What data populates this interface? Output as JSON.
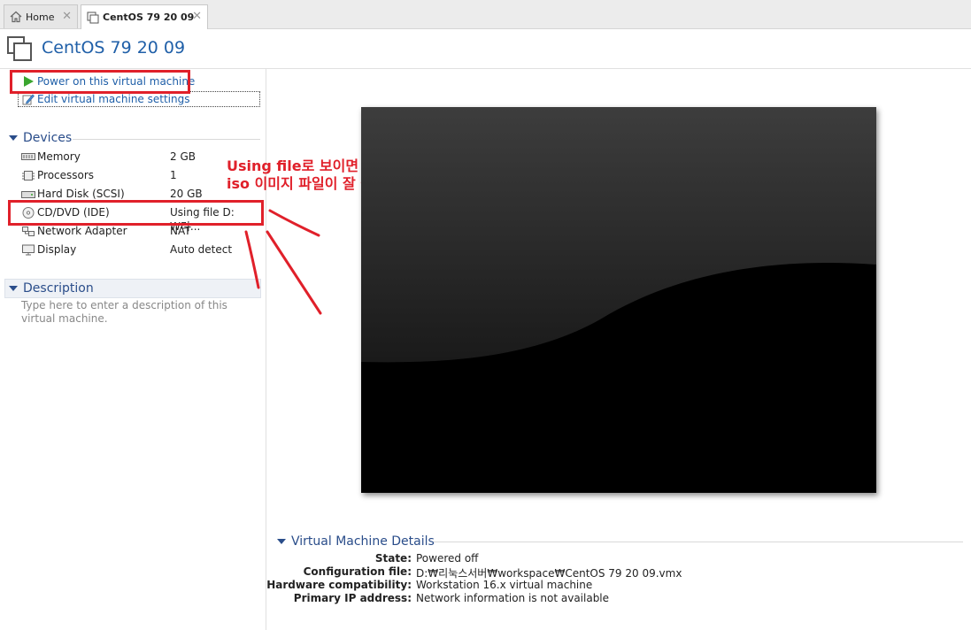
{
  "tabs": [
    {
      "label": "Home"
    },
    {
      "label": "CentOS 79 20 09"
    }
  ],
  "header": {
    "title": "CentOS 79 20 09"
  },
  "actions": {
    "power_on": "Power on this virtual machine",
    "edit_settings": "Edit virtual machine settings"
  },
  "devices": {
    "heading": "Devices",
    "items": [
      {
        "name": "Memory",
        "value": "2 GB"
      },
      {
        "name": "Processors",
        "value": "1"
      },
      {
        "name": "Hard Disk (SCSI)",
        "value": "20 GB"
      },
      {
        "name": "CD/DVD (IDE)",
        "value": "Using file D:₩리..."
      },
      {
        "name": "Network Adapter",
        "value": "NAT"
      },
      {
        "name": "Display",
        "value": "Auto detect"
      }
    ]
  },
  "description": {
    "heading": "Description",
    "placeholder": "Type here to enter a description of this virtual machine."
  },
  "annotation": {
    "line1": "Using file로 보이면",
    "line2": "iso 이미지 파일이 잘 들어간 거임!!",
    "color": "#e0202a"
  },
  "details": {
    "heading": "Virtual Machine Details",
    "rows": [
      {
        "label": "State:",
        "value": "Powered off"
      },
      {
        "label": "Configuration file:",
        "value": "D:₩리눅스서버₩workspace₩CentOS 79 20 09.vmx"
      },
      {
        "label": "Hardware compatibility:",
        "value": "Workstation 16.x virtual machine"
      },
      {
        "label": "Primary IP address:",
        "value": "Network information is not available"
      }
    ]
  },
  "colors": {
    "accent": "#1f5fa8",
    "power_green": "#3aa62f",
    "annotation_red": "#e0202a"
  }
}
